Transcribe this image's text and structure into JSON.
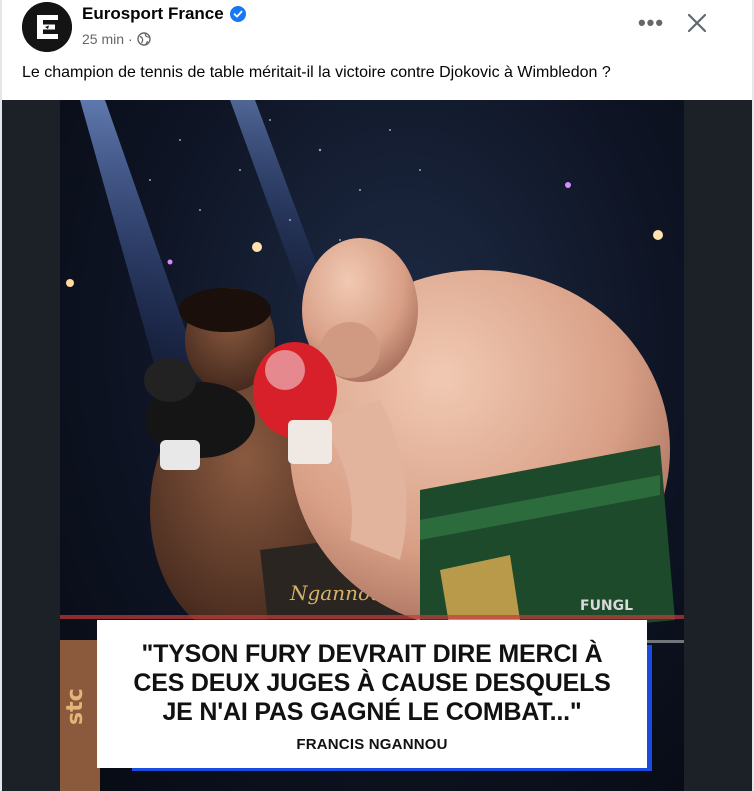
{
  "post": {
    "page_name": "Eurosport France",
    "timestamp": "25 min",
    "separator": "·",
    "audience_icon": "globe-icon",
    "verified_icon": "verified-badge-icon",
    "more_icon": "more-options-icon",
    "more_label": "•••",
    "close_icon": "close-icon",
    "text": "Le champion de tennis de table méritait-il la victoire contre Djokovic à Wimbledon ?"
  },
  "media": {
    "quote_lines": [
      "\"TYSON FURY DEVRAIT DIRE MERCI À",
      "CES DEUX JUGES À CAUSE DESQUELS",
      "JE N'AI PAS GAGNÉ LE COMBAT...\""
    ],
    "quote_author": "FRANCIS NGANNOU",
    "colors": {
      "accent_frame": "#1a4be0",
      "verified": "#1877f2",
      "background": "#1c2128"
    }
  }
}
